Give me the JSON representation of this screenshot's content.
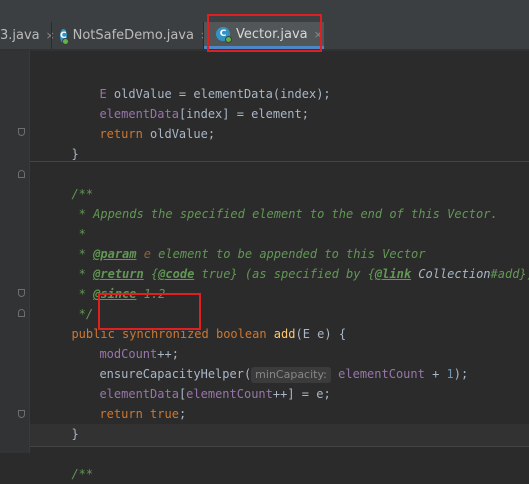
{
  "tabs": [
    {
      "label": "3.java",
      "close": "×"
    },
    {
      "label": "NotSafeDemo.java",
      "close": "×",
      "icon": "C"
    },
    {
      "label": "Vector.java",
      "close": "×",
      "icon": "C"
    }
  ],
  "code": {
    "l1": {
      "type": "E",
      "rest": " oldValue = elementData(index);"
    },
    "l2": {
      "field": "elementData",
      "rest": "[index] = element;"
    },
    "l3": {
      "kw": "return",
      "rest": " oldValue;"
    },
    "l4": "}",
    "d1": "/**",
    "d2": " * Appends the specified element to the end of this Vector.",
    "d3": " *",
    "d4": {
      "star": " * ",
      "tag": "@param",
      "ref": " e",
      "rest": " element to be appended to this Vector"
    },
    "d5": {
      "star": " * ",
      "tag": "@return",
      "a": " {",
      "code": "@code",
      "b": " true} (as specified by {",
      "link": "@link",
      "c": " ",
      "coll": "Collection",
      "d": "#add})"
    },
    "d6": {
      "star": " * ",
      "tag": "@since",
      "rest": " 1.2"
    },
    "d7": " */",
    "sig": {
      "public": "public",
      "sync": "synchronized",
      "bool": "boolean",
      "name": "add",
      "params": "(E e) {"
    },
    "b1": {
      "field": "modCount",
      "rest": "++;"
    },
    "b2": {
      "call": "ensureCapacityHelper(",
      "hint": "minCapacity:",
      "field": "elementCount",
      "op": " + ",
      "num": "1",
      "end": ");"
    },
    "b3": {
      "field1": "elementData",
      "br1": "[",
      "field2": "elementCount",
      "rest": "++] = e;"
    },
    "b4": {
      "kw": "return",
      "val": " true",
      "end": ";"
    },
    "close": "}",
    "next": "/**"
  },
  "colors": {
    "highlight_box": "#e02020",
    "keyword": "#cc7832",
    "doc_comment": "#629755",
    "field": "#9876aa"
  }
}
